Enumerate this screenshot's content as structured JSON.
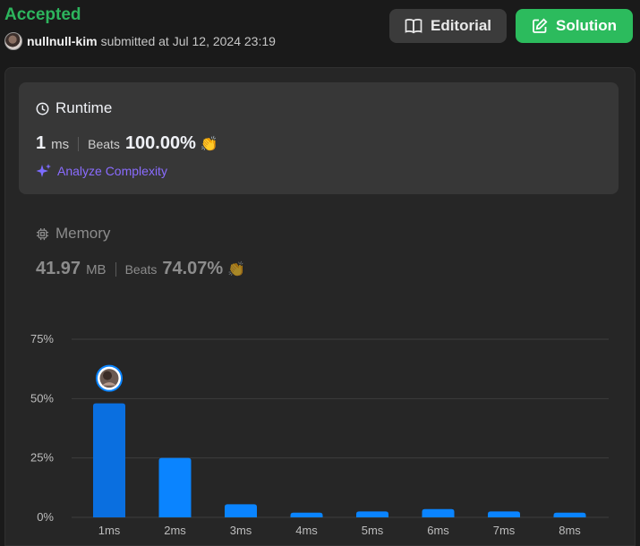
{
  "header": {
    "status": "Accepted",
    "username": "nullnull-kim",
    "submitted_text": "submitted at Jul 12, 2024 23:19",
    "editorial_label": "Editorial",
    "solution_label": "Solution"
  },
  "runtime": {
    "title": "Runtime",
    "value": "1",
    "unit": "ms",
    "beats_label": "Beats",
    "beats_value": "100.00%",
    "analyze_label": "Analyze Complexity"
  },
  "memory": {
    "title": "Memory",
    "value": "41.97",
    "unit": "MB",
    "beats_label": "Beats",
    "beats_value": "74.07%"
  },
  "colors": {
    "accepted": "#2db55d",
    "bar": "#0a84ff",
    "bar_highlight": "#0a6fe0",
    "analyze": "#8a6cff"
  },
  "chart_data": {
    "type": "bar",
    "categories": [
      "1ms",
      "2ms",
      "3ms",
      "4ms",
      "5ms",
      "6ms",
      "7ms",
      "8ms"
    ],
    "values": [
      48,
      25,
      5.5,
      2,
      2.5,
      3.5,
      2.5,
      2
    ],
    "ylim": [
      0,
      75
    ],
    "yticks": [
      0,
      25,
      50,
      75
    ],
    "ytick_labels": [
      "0%",
      "25%",
      "50%",
      "75%"
    ],
    "highlight_index": 0,
    "grid": true
  }
}
